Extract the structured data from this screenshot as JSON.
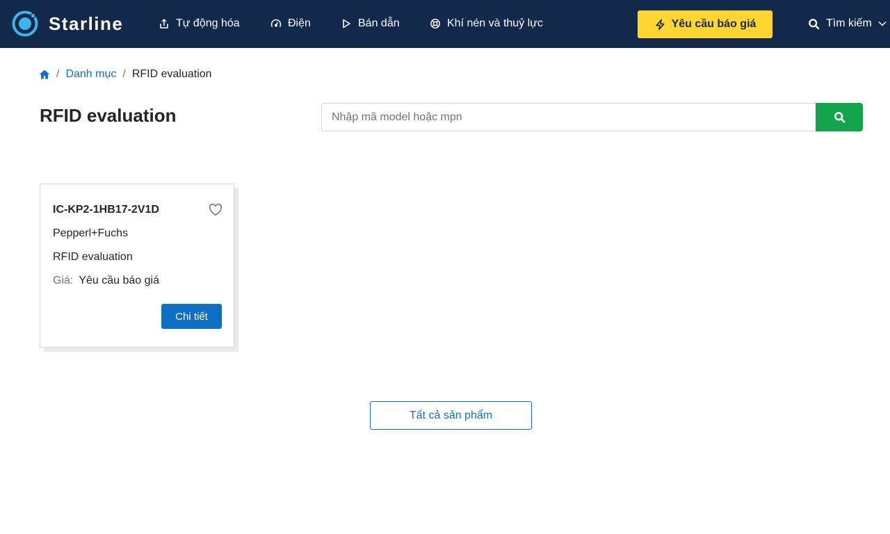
{
  "colors": {
    "navbar": "#13294b",
    "accent_yellow": "#ffd531",
    "link_blue": "#0f6fc5",
    "search_green": "#14a44d"
  },
  "header": {
    "brand": "Starline",
    "nav": [
      {
        "label": "Tự động hóa",
        "icon": "upload-icon"
      },
      {
        "label": "Điện",
        "icon": "gauge-icon"
      },
      {
        "label": "Bán dẫn",
        "icon": "play-icon"
      },
      {
        "label": "Khí nén và thuỷ lực",
        "icon": "lifebuoy-icon"
      }
    ],
    "quote_button": "Yêu cầu báo giá",
    "search_toggle": "Tìm kiếm"
  },
  "breadcrumb": {
    "home_icon": "home-icon",
    "items": [
      "Danh mục",
      "RFID evaluation"
    ]
  },
  "page_title": "RFID evaluation",
  "search": {
    "placeholder": "Nhập mã model hoặc mpn",
    "value": ""
  },
  "products": [
    {
      "model": "IC-KP2-1HB17-2V1D",
      "brand": "Pepperl+Fuchs",
      "category": "RFID evaluation",
      "price_label": "Giá:",
      "price_value": "Yêu cầu báo giá",
      "detail_button": "Chi tiết"
    }
  ],
  "all_products_button": "Tất cả sản phẩm"
}
